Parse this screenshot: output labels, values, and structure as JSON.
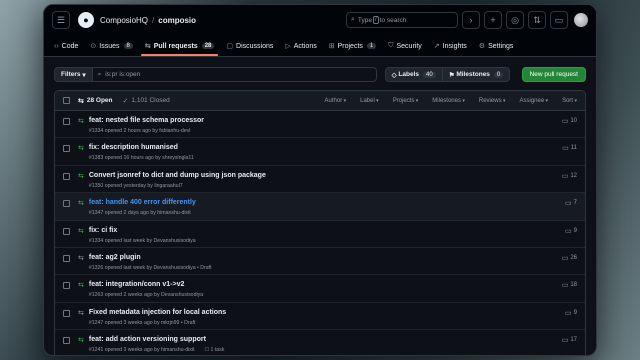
{
  "header": {
    "owner": "ComposioHQ",
    "repo": "composio",
    "search_placeholder": "Type",
    "search_suffix": "to search",
    "search_key": "/"
  },
  "nav": {
    "tabs": [
      {
        "label": "Code",
        "icon": "code-icon",
        "count": ""
      },
      {
        "label": "Issues",
        "icon": "issue-icon",
        "count": "8"
      },
      {
        "label": "Pull requests",
        "icon": "pull-request-icon",
        "count": "28"
      },
      {
        "label": "Discussions",
        "icon": "discussion-icon",
        "count": ""
      },
      {
        "label": "Actions",
        "icon": "play-icon",
        "count": ""
      },
      {
        "label": "Projects",
        "icon": "table-icon",
        "count": "1"
      },
      {
        "label": "Security",
        "icon": "shield-icon",
        "count": ""
      },
      {
        "label": "Insights",
        "icon": "graph-icon",
        "count": ""
      },
      {
        "label": "Settings",
        "icon": "gear-icon",
        "count": ""
      }
    ]
  },
  "filters": {
    "button": "Filters",
    "query": "is:pr is:open",
    "labels_label": "Labels",
    "labels_count": "40",
    "milestones_label": "Milestones",
    "milestones_count": "0",
    "new_pr": "New pull request"
  },
  "list": {
    "open_label": "28 Open",
    "closed_label": "1,101 Closed",
    "sorts": [
      "Author",
      "Label",
      "Projects",
      "Milestones",
      "Reviews",
      "Assignee",
      "Sort"
    ],
    "rows": [
      {
        "title": "feat: nested file schema processor",
        "meta": "#1334 opened 2 hours ago by fabianhu-devl",
        "comments": "10",
        "draft": false,
        "task": ""
      },
      {
        "title": "fix: description humanised",
        "meta": "#1383 opened 16 hours ago by shreysingla11",
        "comments": "11",
        "draft": false,
        "task": ""
      },
      {
        "title": "Convert jsonref to dict and dump using json package",
        "meta": "#1350 opened yesterday by lingaraahul7",
        "comments": "12",
        "draft": false,
        "task": ""
      },
      {
        "title": "feat: handle 400 error differently",
        "meta": "#1347 opened 2 days ago by himanshu-dixit",
        "comments": "7",
        "draft": false,
        "task": ""
      },
      {
        "title": "fix: ci fix",
        "meta": "#1334 opened last week by Devanshusisodiya",
        "comments": "9",
        "draft": false,
        "task": ""
      },
      {
        "title": "feat: ag2 plugin",
        "meta": "#1326 opened last week by Devanshusisodiya • Draft",
        "comments": "26",
        "draft": true,
        "task": ""
      },
      {
        "title": "feat: integration/conn v1->v2",
        "meta": "#1263 opened 2 weeks ago by Devanshusisodiya",
        "comments": "18",
        "draft": false,
        "task": ""
      },
      {
        "title": "Fixed metadata injection for local actions",
        "meta": "#1247 opened 3 weeks ago by mkrjn99 • Draft",
        "comments": "9",
        "draft": true,
        "task": ""
      },
      {
        "title": "feat: add action versioning support",
        "meta": "#1241 opened 3 weeks ago by himanshu-dixit",
        "comments": "17",
        "draft": false,
        "task": "1 task"
      }
    ]
  },
  "colors": {
    "accent": "#f78166",
    "open": "#3fb950",
    "link": "#4493f8",
    "new_pr": "#238636"
  }
}
